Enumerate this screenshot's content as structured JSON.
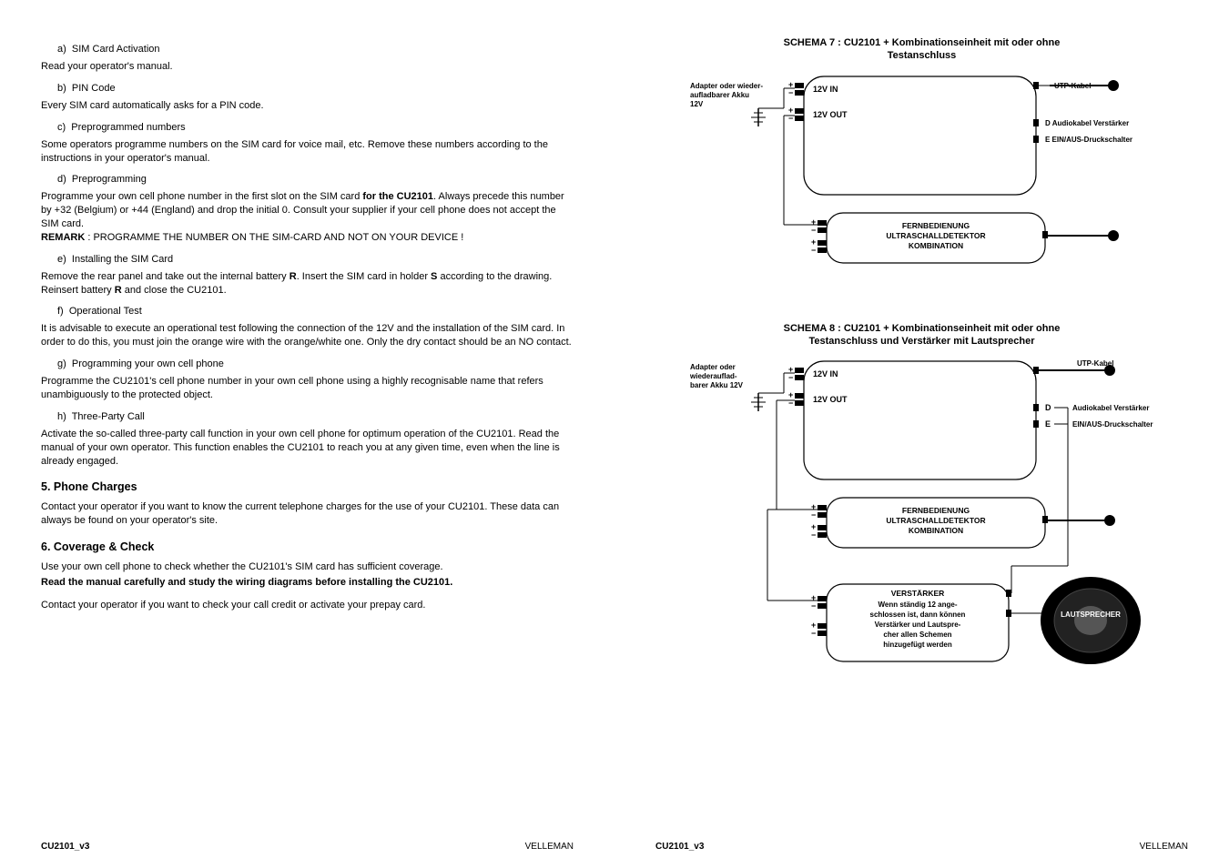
{
  "left": {
    "items": [
      {
        "letter": "a)",
        "title": "SIM Card Activation"
      },
      {
        "letter": "b)",
        "title": "PIN Code"
      },
      {
        "letter": "c)",
        "title": "Preprogrammed numbers"
      },
      {
        "letter": "d)",
        "title": "Preprogramming"
      },
      {
        "letter": "e)",
        "title": "Installing the SIM Card"
      },
      {
        "letter": "f)",
        "title": "Operational Test"
      },
      {
        "letter": "g)",
        "title": "Programming your own cell phone"
      },
      {
        "letter": "h)",
        "title": "Three-Party Call"
      }
    ],
    "p_a": "Read your operator's manual.",
    "p_b": "Every SIM card automatically asks for a PIN code.",
    "p_c": "Some operators programme numbers on the SIM card for voice mail, etc. Remove these numbers according to the instructions in your operator's manual.",
    "p_d1_pre": "Programme your own cell phone number in the first slot on the SIM card ",
    "p_d1_bold": "for the CU2101",
    "p_d1_post": ". Always precede this number by +32 (Belgium) or +44 (England) and drop the initial 0. Consult your supplier if your cell phone does not accept the SIM card.",
    "p_d2_bold": "REMARK",
    "p_d2_rest": " : PROGRAMME THE NUMBER ON THE SIM-CARD AND NOT ON YOUR DEVICE !",
    "p_e_pre": "Remove the rear panel and take out the internal battery ",
    "p_e_r1": "R",
    "p_e_mid": ". Insert the SIM card in holder ",
    "p_e_s": "S",
    "p_e_mid2": " according to the drawing. Reinsert battery ",
    "p_e_r2": "R",
    "p_e_post": " and close the CU2101.",
    "p_f": "It is advisable to execute an operational test following the connection of the 12V and the installation of the SIM card. In order to do this, you must join the orange wire with the orange/white one. Only the dry contact should be an NO contact.",
    "p_g": "Programme the CU2101's cell phone number in your own cell phone using a highly recognisable name that refers unambiguously to the protected object.",
    "p_h": "Activate the so-called three-party call function in your own cell phone for optimum operation of the CU2101. Read the manual of your own operator. This function enables the CU2101 to reach you at any given time, even when the line is already engaged.",
    "h5": "5.  Phone Charges",
    "p_5": "Contact your operator if you want to know the current telephone charges for the use of your CU2101. These data can always be found on your operator's site.",
    "h6": "6.  Coverage & Check",
    "p_6a": "Use your own cell phone to check whether the CU2101's SIM card has sufficient coverage.",
    "p_6b": "Read the manual carefully and study the wiring diagrams before installing the CU2101.",
    "p_6c": "Contact your operator if you want to check your call credit or activate your prepay card.",
    "footer_left": "CU2101_v3",
    "footer_right": "VELLEMAN"
  },
  "right": {
    "schema7_title_l1": "SCHEMA 7 : CU2101 + Kombinationseinheit mit oder ohne",
    "schema7_title_l2": "Testanschluss",
    "schema8_title_l1": "SCHEMA 8 : CU2101 + Kombinationseinheit mit oder ohne",
    "schema8_title_l2": "Testanschluss und Verstärker mit Lautsprecher",
    "labels": {
      "adapter7": "Adapter oder wieder-\naufladbarer Akku\n12V",
      "adapter8": "Adapter oder\nwiederauflad-\nbarer Akku 12V",
      "v12in": "12V IN",
      "v12out": "12V OUT",
      "utp": "UTP-Kabel",
      "d_audio": "D Audiokabel Verstärker",
      "e_switch": "E EIN/AUS-Druckschalter",
      "d": "D",
      "e": "E",
      "audio": "Audiokabel Verstärker",
      "switch": "EIN/AUS-Druckschalter",
      "combo_l1": "FERNBEDIENUNG",
      "combo_l2": "ULTRASCHALLDETEKTOR",
      "combo_l3": "KOMBINATION",
      "verst_l1": "VERSTÄRKER",
      "verst_l2": "Wenn ständig 12 ange-",
      "verst_l3": "schlossen ist, dann können",
      "verst_l4": "Verstärker und Lautspre-",
      "verst_l5": "cher allen Schemen",
      "verst_l6": "hinzugefügt werden",
      "speaker": "LAUTSPRECHER"
    },
    "footer_left": "CU2101_v3",
    "footer_right": "VELLEMAN"
  }
}
